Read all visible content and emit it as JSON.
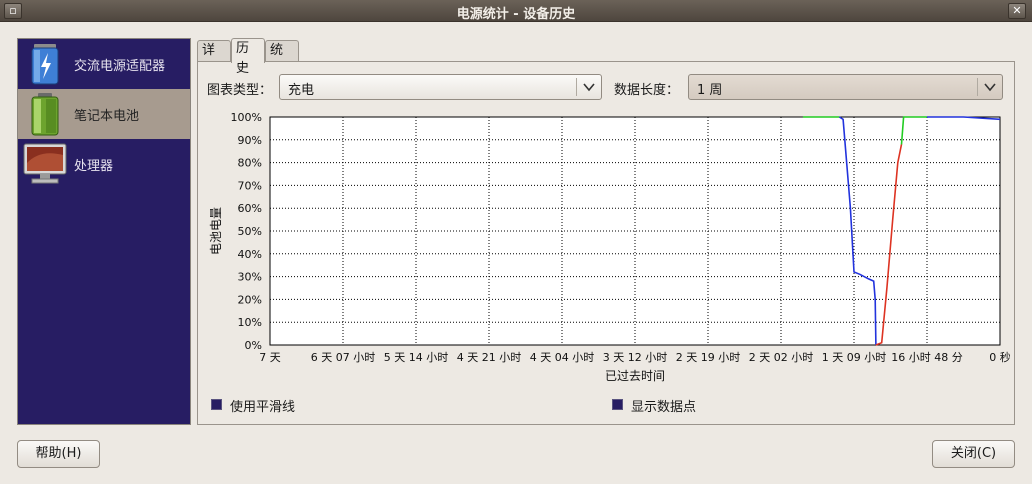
{
  "window": {
    "title": "电源统计 - 设备历史",
    "close_label": "✕",
    "left_label": "▫"
  },
  "devices": [
    {
      "label": "交流电源适配器",
      "icon": "ac-adapter-icon"
    },
    {
      "label": "笔记本电池",
      "icon": "battery-icon",
      "selected": true
    },
    {
      "label": "处理器",
      "icon": "processor-icon"
    }
  ],
  "tabs": [
    {
      "label": "详细"
    },
    {
      "label": "历史",
      "active": true
    },
    {
      "label": "统计"
    }
  ],
  "controls": {
    "graph_type_label": "图表类型：",
    "graph_type_value": "充电",
    "data_length_label": "数据长度：",
    "data_length_value": "1 周"
  },
  "options": {
    "smooth_label": "使用平滑线",
    "points_label": "显示数据点"
  },
  "buttons": {
    "help": "帮助(H)",
    "close": "关闭(C)"
  },
  "colors": {
    "discharging": "#2233dd",
    "charging": "#dd3322",
    "full": "#22cc22",
    "sidebar_bg": "#271d63"
  },
  "chart_data": {
    "type": "line",
    "xlabel": "已过去时间",
    "ylabel": "电池电量",
    "yticks": [
      "0%",
      "10%",
      "20%",
      "30%",
      "40%",
      "50%",
      "60%",
      "70%",
      "80%",
      "90%",
      "100%"
    ],
    "xticks": [
      "7 天",
      "6 天 07 小时",
      "5 天 14 小时",
      "4 天 21 小时",
      "4 天 04 小时",
      "3 天 12 小时",
      "2 天 19 小时",
      "2 天 02 小时",
      "1 天 09 小时",
      "16 小时 48 分",
      "0 秒"
    ],
    "ylim": [
      0,
      100
    ],
    "grid": true,
    "series": [
      {
        "state": "full",
        "points": [
          [
            0.73,
            100
          ],
          [
            0.78,
            100
          ]
        ]
      },
      {
        "state": "discharging",
        "points": [
          [
            0.78,
            100
          ],
          [
            0.785,
            99
          ],
          [
            0.795,
            60
          ],
          [
            0.8,
            32
          ],
          [
            0.808,
            31
          ],
          [
            0.82,
            29
          ],
          [
            0.827,
            28
          ],
          [
            0.829,
            20
          ],
          [
            0.83,
            0
          ]
        ]
      },
      {
        "state": "charging",
        "points": [
          [
            0.83,
            0
          ],
          [
            0.838,
            1
          ],
          [
            0.845,
            25
          ],
          [
            0.853,
            55
          ],
          [
            0.86,
            80
          ],
          [
            0.865,
            88
          ]
        ]
      },
      {
        "state": "full",
        "points": [
          [
            0.865,
            88
          ],
          [
            0.868,
            100
          ],
          [
            0.9,
            100
          ]
        ]
      },
      {
        "state": "discharging",
        "points": [
          [
            0.9,
            100
          ],
          [
            0.95,
            100
          ],
          [
            1.0,
            99
          ]
        ]
      }
    ]
  }
}
